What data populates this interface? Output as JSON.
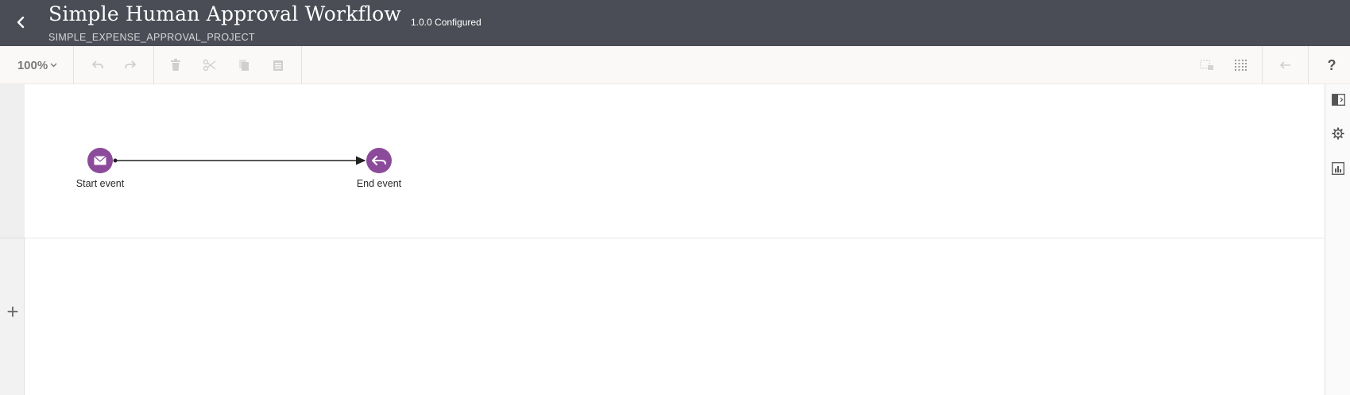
{
  "header": {
    "title": "Simple Human Approval Workflow",
    "subtitle": "SIMPLE_EXPENSE_APPROVAL_PROJECT",
    "version_status": "1.0.0 Configured",
    "background_color": "#4a4d55"
  },
  "toolbar": {
    "zoom_level": "100%",
    "icons": [
      "undo-icon",
      "redo-icon",
      "delete-icon",
      "cut-icon",
      "copy-icon",
      "paste-icon",
      "select-lock-icon",
      "grid-icon",
      "collapse-icon"
    ],
    "help_label": "?"
  },
  "canvas": {
    "add_lane_label": "+",
    "nodes": [
      {
        "id": "start",
        "label": "Start event",
        "type": "message-start",
        "icon": "envelope-icon"
      },
      {
        "id": "end",
        "label": "End event",
        "type": "return-end",
        "icon": "return-arrow-icon"
      }
    ],
    "flows": [
      {
        "from": "start",
        "to": "end"
      }
    ],
    "node_color": "#8b4b9a"
  },
  "right_rail": {
    "icons": [
      "panel-toggle-icon",
      "settings-icon",
      "chart-icon"
    ]
  }
}
